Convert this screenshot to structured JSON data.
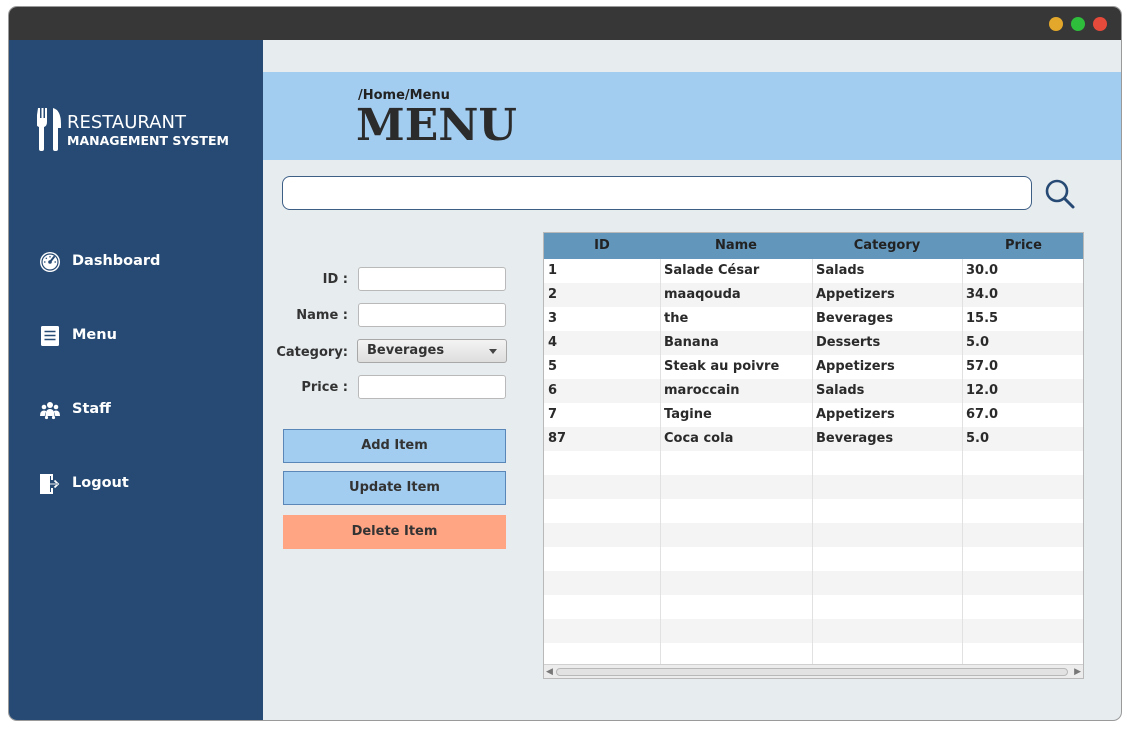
{
  "app": {
    "logo_title": "RESTAURANT",
    "logo_subtitle": "MANAGEMENT SYSTEM"
  },
  "sidebar": {
    "items": [
      {
        "label": "Dashboard",
        "icon": "dashboard-gauge-icon"
      },
      {
        "label": "Menu",
        "icon": "menu-list-icon"
      },
      {
        "label": "Staff",
        "icon": "staff-group-icon"
      },
      {
        "label": "Logout",
        "icon": "logout-icon"
      }
    ]
  },
  "header": {
    "breadcrumb": "/Home/Menu",
    "title": "MENU"
  },
  "search": {
    "value": "",
    "placeholder": ""
  },
  "form": {
    "id_label": "ID :",
    "name_label": "Name :",
    "category_label": "Category:",
    "price_label": "Price :",
    "id_value": "",
    "name_value": "",
    "price_value": "",
    "category_selected": "Beverages"
  },
  "buttons": {
    "add": "Add Item",
    "update": "Update Item",
    "delete": "Delete Item"
  },
  "table": {
    "columns": [
      "ID",
      "Name",
      "Category",
      "Price"
    ],
    "rows": [
      [
        "1",
        "Salade César",
        "Salads",
        "30.0"
      ],
      [
        "2",
        "maaqouda",
        "Appetizers",
        "34.0"
      ],
      [
        "3",
        "the",
        "Beverages",
        "15.5"
      ],
      [
        "4",
        "Banana",
        "Desserts",
        "5.0"
      ],
      [
        "5",
        "Steak au poivre",
        "Appetizers",
        "57.0"
      ],
      [
        "6",
        "maroccain",
        "Salads",
        "12.0"
      ],
      [
        "7",
        "Tagine",
        "Appetizers",
        "67.0"
      ],
      [
        "87",
        "Coca cola",
        "Beverages",
        "5.0"
      ]
    ]
  },
  "colors": {
    "sidebar": "#264a73",
    "header": "#a3cdf0",
    "table_header": "#6396bb",
    "primary_button": "#a3cdf0",
    "danger_button": "#ffa584"
  }
}
